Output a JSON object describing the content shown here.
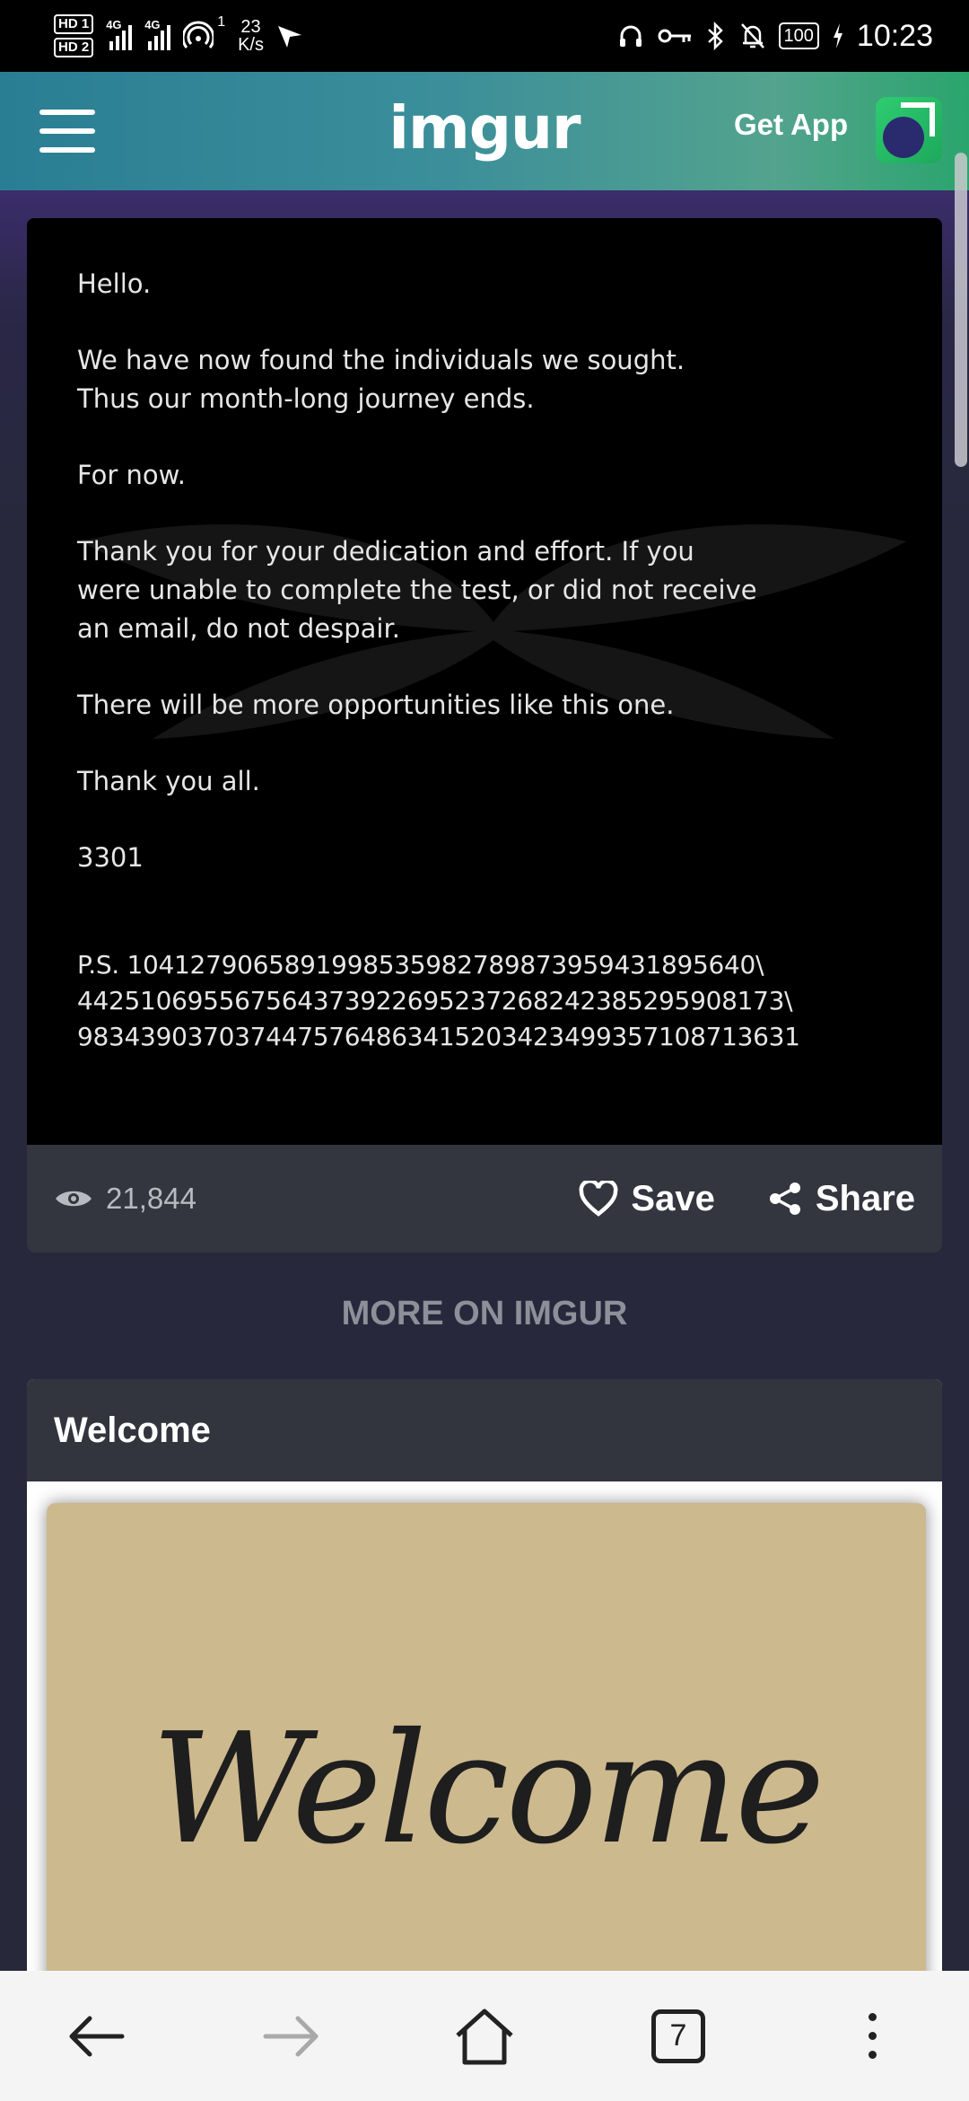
{
  "status_bar": {
    "hd1": "HD 1",
    "hd2": "HD 2",
    "network1": "4G",
    "network2": "4G",
    "hotspot_count": "1",
    "speed_value": "23",
    "speed_unit": "K/s",
    "battery": "100",
    "time": "10:23"
  },
  "app_bar": {
    "logo": "imgur",
    "get_app_label": "Get App"
  },
  "post": {
    "lines": [
      "Hello.",
      "We have now found the individuals we sought.\nThus our month-long journey ends.",
      "For now.",
      "Thank you for your dedication and effort.  If you\nwere unable to complete the test, or did not receive\nan email, do not despair.",
      "There will be more opportunities like this one.",
      "Thank you all.",
      "3301",
      "P.S. 1041279065891998535982789873959431895640\\\n442510695567564373922695237268242385295908173\\\n9834390370374475764863415203423499357108713631"
    ],
    "views": "21,844",
    "save_label": "Save",
    "share_label": "Share"
  },
  "more_label": "MORE ON IMGUR",
  "next_post": {
    "title": "Welcome",
    "image_text": "Welcome"
  },
  "bottom_nav": {
    "tab_count": "7"
  }
}
